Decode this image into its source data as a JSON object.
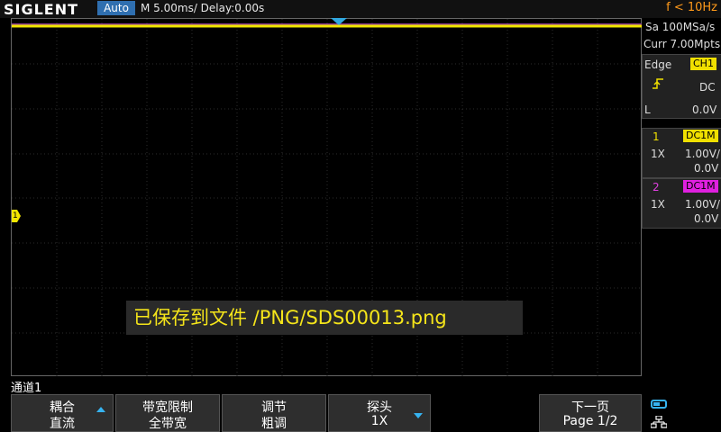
{
  "header": {
    "brand": "SIGLENT",
    "run_status": "Auto",
    "timebase": "M 5.00ms/ Delay:0.00s",
    "frequency": "f < 10Hz"
  },
  "acquisition": {
    "sample_rate": "Sa 100MSa/s",
    "memory_depth": "Curr 7.00Mpts"
  },
  "trigger": {
    "type": "Edge",
    "source": "CH1",
    "coupling": "DC",
    "level_prefix": "L",
    "level": "0.0V",
    "slope_icon": "rising-edge-icon"
  },
  "channels": [
    {
      "num": "1",
      "coupling": "DC1M",
      "probe": "1X",
      "scale": "1.00V/",
      "offset": "0.0V",
      "color": "#f0e000"
    },
    {
      "num": "2",
      "coupling": "DC1M",
      "probe": "1X",
      "scale": "1.00V/",
      "offset": "0.0V",
      "color": "#e020e0"
    }
  ],
  "plot": {
    "ch1_marker_label": "1"
  },
  "toast": "已保存到文件 /PNG/SDS00013.png",
  "menu": {
    "title": "通道1",
    "softkeys": [
      {
        "line1": "耦合",
        "line2": "直流",
        "arrow": "up"
      },
      {
        "line1": "带宽限制",
        "line2": "全带宽",
        "arrow": ""
      },
      {
        "line1": "调节",
        "line2": "粗调",
        "arrow": ""
      },
      {
        "line1": "探头",
        "line2": "1X",
        "arrow": "down"
      },
      {
        "line1": "下一页",
        "line2": "Page 1/2",
        "arrow": ""
      }
    ]
  },
  "icons": {
    "toggle": "display-toggle-icon",
    "network": "network-icon"
  }
}
